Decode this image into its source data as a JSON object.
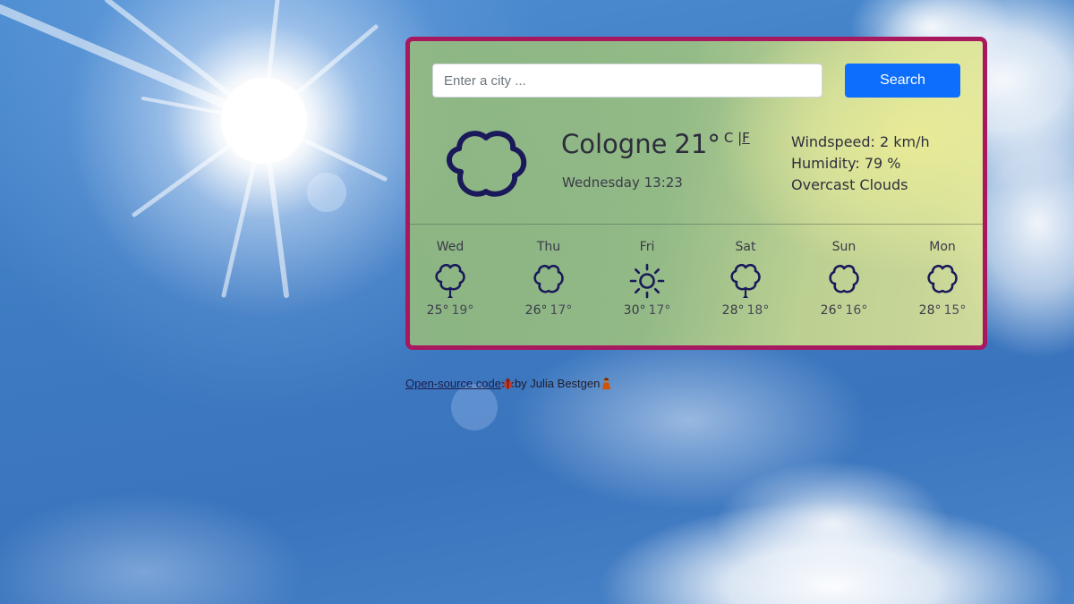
{
  "search": {
    "placeholder": "Enter a city ...",
    "value": "",
    "button_label": "Search"
  },
  "current": {
    "city": "Cologne",
    "temperature": "21°",
    "unit_c": "C",
    "unit_separator": "|",
    "unit_f": "F",
    "datetime": "Wednesday 13:23",
    "icon": "cloud-icon",
    "windspeed": "Windspeed: 2 km/h",
    "humidity": "Humidity: 79 %",
    "description": "Overcast Clouds"
  },
  "forecast": [
    {
      "day": "Wed",
      "max": "25°",
      "min": "19°",
      "icon": "cloud-rain-icon"
    },
    {
      "day": "Thu",
      "max": "26°",
      "min": "17°",
      "icon": "cloud-icon"
    },
    {
      "day": "Fri",
      "max": "30°",
      "min": "17°",
      "icon": "sun-icon"
    },
    {
      "day": "Sat",
      "max": "28°",
      "min": "18°",
      "icon": "cloud-rain-icon"
    },
    {
      "day": "Sun",
      "max": "26°",
      "min": "16°",
      "icon": "cloud-icon"
    },
    {
      "day": "Mon",
      "max": "28°",
      "min": "15°",
      "icon": "cloud-icon"
    }
  ],
  "footer": {
    "link_text": "Open-source code",
    "by_text": "by Julia Bestgen",
    "icons": [
      "bug-icon",
      "person-icon"
    ]
  },
  "colors": {
    "card_border": "#a8185f",
    "button": "#0d6efd",
    "icon_stroke": "#1a1a5a"
  }
}
